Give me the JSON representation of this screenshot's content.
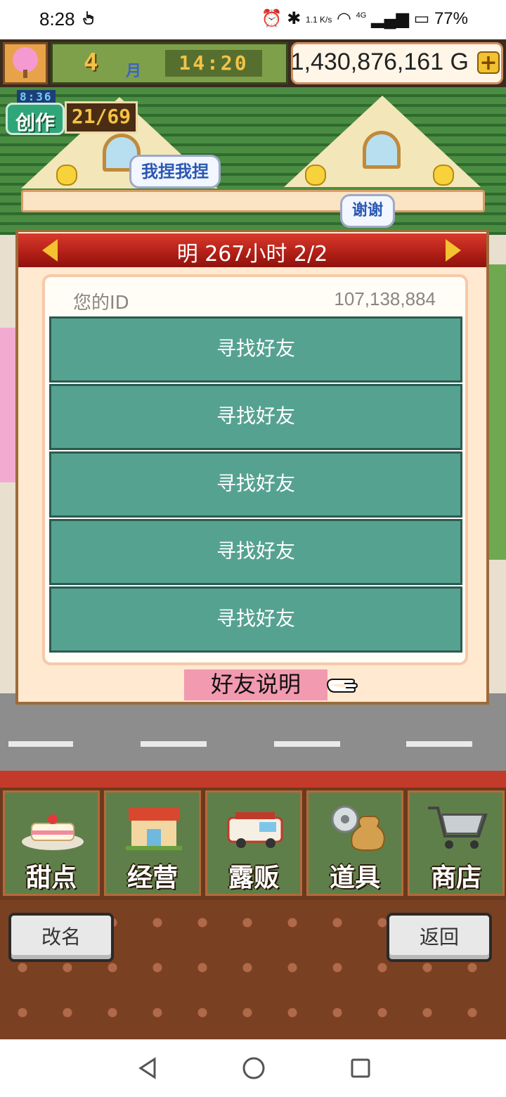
{
  "status_bar": {
    "time": "8:28",
    "network_speed": "1.1 K/s",
    "network_type": "4G",
    "battery": "77%"
  },
  "hud": {
    "month": "4",
    "month_unit": "月",
    "time": "14:20",
    "gold": "1,430,876,161 G",
    "gold_plus": "+"
  },
  "creation_badge": {
    "timer": "8:36",
    "label": "创作",
    "count": "21/69"
  },
  "speech_bubbles": [
    "我捏我捏",
    "谢谢"
  ],
  "friend_panel": {
    "title": "明  267小时 2/2",
    "id_label": "您的ID",
    "id_value": "107,138,884",
    "slots": [
      "寻找好友",
      "寻找好友",
      "寻找好友",
      "寻找好友",
      "寻找好友"
    ],
    "help_label": "好友说明"
  },
  "menu": {
    "items": [
      {
        "label": "甜点",
        "icon": "cake-icon"
      },
      {
        "label": "经营",
        "icon": "shop-icon"
      },
      {
        "label": "露贩",
        "icon": "food-truck-icon"
      },
      {
        "label": "道具",
        "icon": "gear-bag-icon"
      },
      {
        "label": "商店",
        "icon": "cart-icon"
      }
    ]
  },
  "bottom_buttons": {
    "rename": "改名",
    "back": "返回"
  },
  "colors": {
    "panel_header": "#c0271e",
    "slot_bg": "#56a291",
    "help_bg": "#f29ab0",
    "gold_box": "#fff6e8"
  }
}
